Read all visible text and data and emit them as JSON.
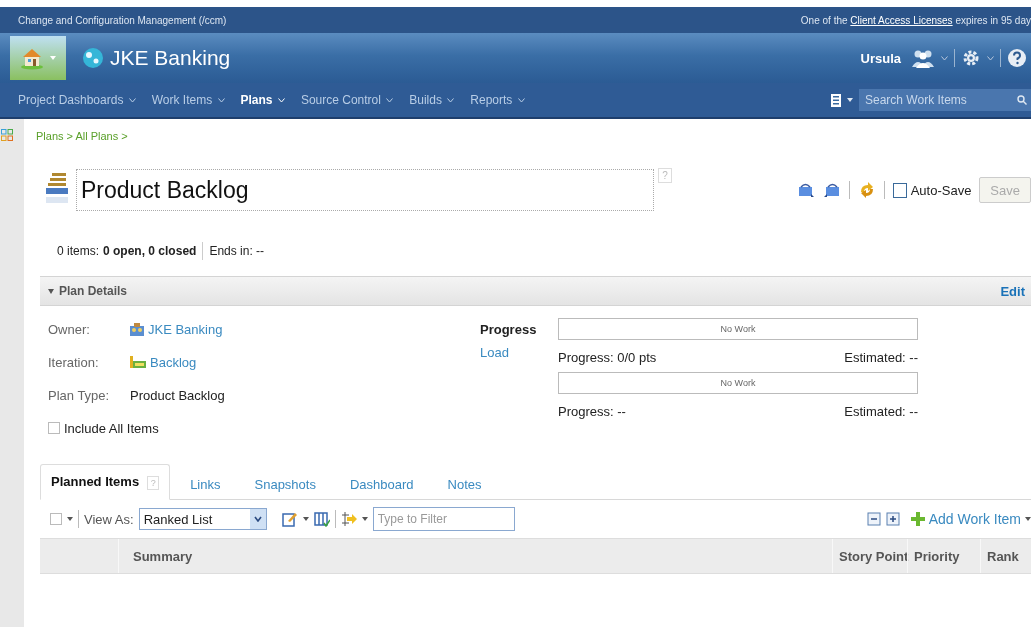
{
  "top_strip": {
    "title": "Change and Configuration Management (/ccm)",
    "notice_before": "One of the",
    "notice_link": "Client Access Licenses",
    "notice_after": "expires in 95 day"
  },
  "banner": {
    "project": "JKE Banking",
    "user": "Ursula"
  },
  "nav": {
    "items": [
      {
        "label": "Project Dashboards",
        "selected": false
      },
      {
        "label": "Work Items",
        "selected": false
      },
      {
        "label": "Plans",
        "selected": true
      },
      {
        "label": "Source Control",
        "selected": false
      },
      {
        "label": "Builds",
        "selected": false
      },
      {
        "label": "Reports",
        "selected": false
      }
    ],
    "search": {
      "placeholder": "Search Work Items"
    }
  },
  "breadcrumb": "Plans > All Plans >",
  "plan": {
    "title": "Product Backlog",
    "help": "?",
    "auto_save": {
      "label": "Auto-Save",
      "checked": false
    },
    "save_button": {
      "label": "Save",
      "disabled": true
    }
  },
  "summary": {
    "items": "0 items:",
    "counts": "0 open, 0 closed",
    "ends": "Ends in: --"
  },
  "plan_details": {
    "title": "Plan Details",
    "expanded": true,
    "edit": "Edit",
    "fields": [
      {
        "label": "Owner:",
        "value": "JKE Banking",
        "kind": "team"
      },
      {
        "label": "Iteration:",
        "value": "Backlog",
        "kind": "iteration"
      },
      {
        "label": "Plan Type:",
        "value": "Product Backlog",
        "kind": "text"
      }
    ],
    "include_all_items": {
      "label": "Include All Items",
      "checked": false
    },
    "progress_title": "Progress",
    "load_link": "Load",
    "bars": [
      {
        "text": "No Work",
        "level": 0,
        "progress": "Progress: 0/0 pts",
        "estimated": "Estimated: --"
      },
      {
        "text": "No Work",
        "level": 0,
        "progress": "Progress: --",
        "estimated": "Estimated: --"
      }
    ]
  },
  "tabs": [
    {
      "label": "Planned Items",
      "selected": true,
      "help": "?"
    },
    {
      "label": "Links",
      "selected": false
    },
    {
      "label": "Snapshots",
      "selected": false
    },
    {
      "label": "Dashboard",
      "selected": false
    },
    {
      "label": "Notes",
      "selected": false
    }
  ],
  "toolbar": {
    "select_all": {
      "checked": false
    },
    "view_as_label": "View As:",
    "view_as_value": "Ranked List",
    "filter": {
      "placeholder": "Type to Filter"
    },
    "add_work_item": "Add Work Item"
  },
  "table": {
    "columns": [
      "Summary",
      "Story Point",
      "Priority",
      "Rank"
    ]
  }
}
